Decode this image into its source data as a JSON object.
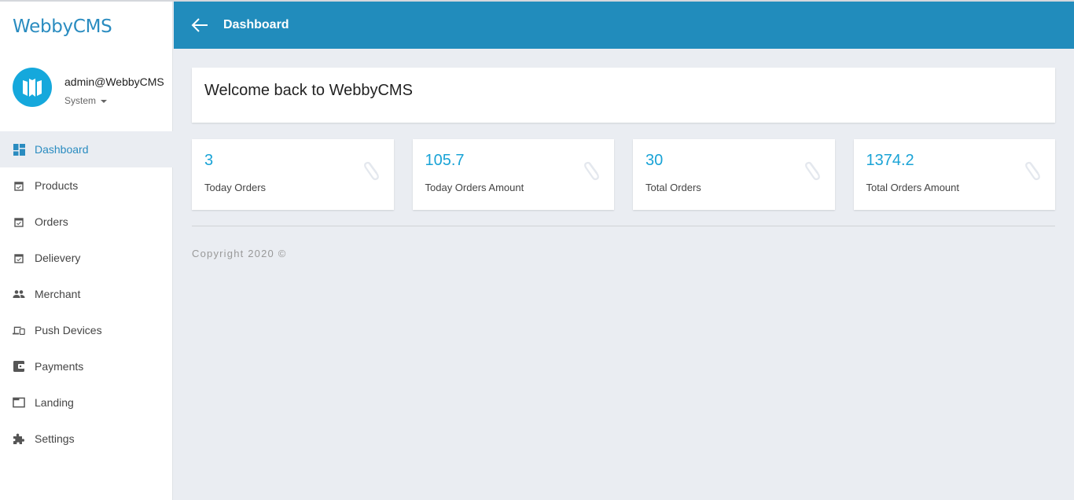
{
  "sidebar": {
    "brand": "WebbyCMS",
    "user": {
      "name": "admin@WebbyCMS",
      "role": "System"
    },
    "items": [
      {
        "label": "Dashboard",
        "icon": "dashboard-icon",
        "active": true
      },
      {
        "label": "Products",
        "icon": "calendar-check-icon"
      },
      {
        "label": "Orders",
        "icon": "calendar-check-icon"
      },
      {
        "label": "Delievery",
        "icon": "calendar-check-icon"
      },
      {
        "label": "Merchant",
        "icon": "people-icon"
      },
      {
        "label": "Push Devices",
        "icon": "devices-icon"
      },
      {
        "label": "Payments",
        "icon": "wallet-icon"
      },
      {
        "label": "Landing",
        "icon": "window-icon"
      },
      {
        "label": "Settings",
        "icon": "puzzle-icon"
      }
    ]
  },
  "header": {
    "title": "Dashboard",
    "back_icon": "arrow-left-icon"
  },
  "welcome": {
    "text": "Welcome back to WebbyCMS"
  },
  "stats": [
    {
      "value": "3",
      "label": "Today Orders",
      "icon": "paperclip-icon"
    },
    {
      "value": "105.7",
      "label": "Today Orders Amount",
      "icon": "paperclip-icon"
    },
    {
      "value": "30",
      "label": "Total Orders",
      "icon": "paperclip-icon"
    },
    {
      "value": "1374.2",
      "label": "Total Orders Amount",
      "icon": "paperclip-icon"
    }
  ],
  "footer": {
    "copyright": "Copyright 2020 ©"
  },
  "colors": {
    "brand": "#2a8cc0",
    "header": "#218cbc",
    "accent": "#19a3d6",
    "background": "#eaedf2"
  }
}
